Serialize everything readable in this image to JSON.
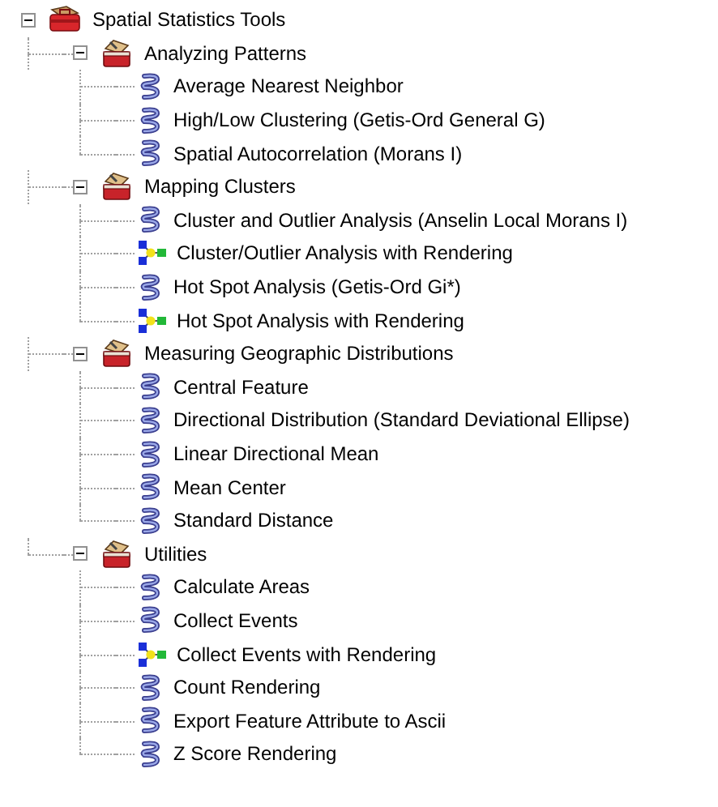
{
  "tree": [
    {
      "label": "Spatial Statistics Tools",
      "kind": "toolbox",
      "expanded": true,
      "children": [
        {
          "label": "Analyzing Patterns",
          "kind": "toolset",
          "expanded": true,
          "children": [
            {
              "label": "Average Nearest Neighbor",
              "kind": "script"
            },
            {
              "label": "High/Low Clustering (Getis-Ord General G)",
              "kind": "script"
            },
            {
              "label": "Spatial Autocorrelation (Morans I)",
              "kind": "script"
            }
          ]
        },
        {
          "label": "Mapping Clusters",
          "kind": "toolset",
          "expanded": true,
          "children": [
            {
              "label": "Cluster and Outlier Analysis (Anselin Local Morans I)",
              "kind": "script"
            },
            {
              "label": "Cluster/Outlier Analysis with Rendering",
              "kind": "model"
            },
            {
              "label": "Hot Spot Analysis (Getis-Ord Gi*)",
              "kind": "script"
            },
            {
              "label": "Hot Spot Analysis with Rendering",
              "kind": "model"
            }
          ]
        },
        {
          "label": "Measuring Geographic Distributions",
          "kind": "toolset",
          "expanded": true,
          "children": [
            {
              "label": "Central Feature",
              "kind": "script"
            },
            {
              "label": "Directional Distribution (Standard Deviational Ellipse)",
              "kind": "script"
            },
            {
              "label": "Linear Directional Mean",
              "kind": "script"
            },
            {
              "label": "Mean Center",
              "kind": "script"
            },
            {
              "label": "Standard Distance",
              "kind": "script"
            }
          ]
        },
        {
          "label": "Utilities",
          "kind": "toolset",
          "expanded": true,
          "children": [
            {
              "label": "Calculate Areas",
              "kind": "script"
            },
            {
              "label": "Collect Events",
              "kind": "script"
            },
            {
              "label": "Collect Events with Rendering",
              "kind": "model"
            },
            {
              "label": "Count Rendering",
              "kind": "script"
            },
            {
              "label": "Export Feature Attribute to Ascii",
              "kind": "script"
            },
            {
              "label": "Z Score Rendering",
              "kind": "script"
            }
          ]
        }
      ]
    }
  ]
}
